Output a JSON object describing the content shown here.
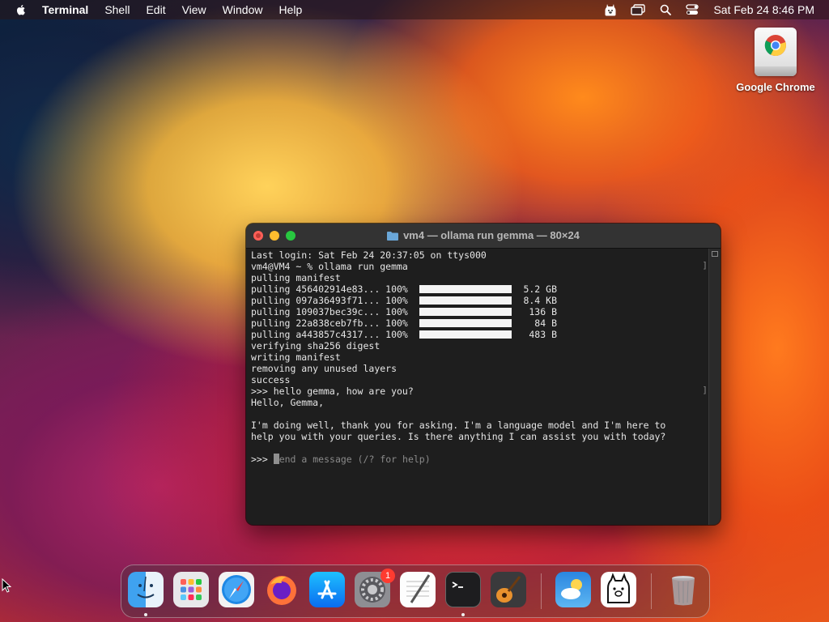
{
  "menubar": {
    "app_name": "Terminal",
    "menus": [
      "Shell",
      "Edit",
      "View",
      "Window",
      "Help"
    ],
    "datetime": "Sat Feb 24  8:46 PM",
    "status_icons": [
      "ollama-menu-icon",
      "screen-mirroring-icon",
      "spotlight-search-icon",
      "control-center-icon"
    ]
  },
  "desktop": {
    "icon_label": "Google Chrome"
  },
  "terminal": {
    "title": "vm4 — ollama run gemma — 80×24",
    "lines_top": [
      "Last login: Sat Feb 24 20:37:05 on ttys000",
      "vm4@VM4 ~ % ollama run gemma",
      "pulling manifest"
    ],
    "pulls": [
      {
        "name": "pulling 456402914e83... 100%",
        "progress": 1.0,
        "size": "5.2 GB"
      },
      {
        "name": "pulling 097a36493f71... 100%",
        "progress": 1.0,
        "size": "8.4 KB"
      },
      {
        "name": "pulling 109037bec39c... 100%",
        "progress": 1.0,
        "size": "136 B"
      },
      {
        "name": "pulling 22a838ceb7fb... 100%",
        "progress": 1.0,
        "size": "84 B"
      },
      {
        "name": "pulling a443857c4317... 100%",
        "progress": 1.0,
        "size": "483 B"
      }
    ],
    "lines_after": [
      "verifying sha256 digest",
      "writing manifest",
      "removing any unused layers",
      "success",
      ">>> hello gemma, how are you?",
      "Hello, Gemma,",
      "",
      "I'm doing well, thank you for asking. I'm a language model and I'm here to",
      "help you with your queries. Is there anything I can assist you with today?",
      ""
    ],
    "prompt": ">>> ",
    "input_placeholder": "Send a message (/? for help)"
  },
  "dock": {
    "items": [
      "Finder",
      "Launchpad",
      "Safari",
      "Firefox",
      "App Store",
      "System Settings",
      "TextEdit",
      "Terminal",
      "GarageBand",
      "Weather",
      "Ollama",
      "Trash"
    ],
    "settings_badge": "1"
  }
}
